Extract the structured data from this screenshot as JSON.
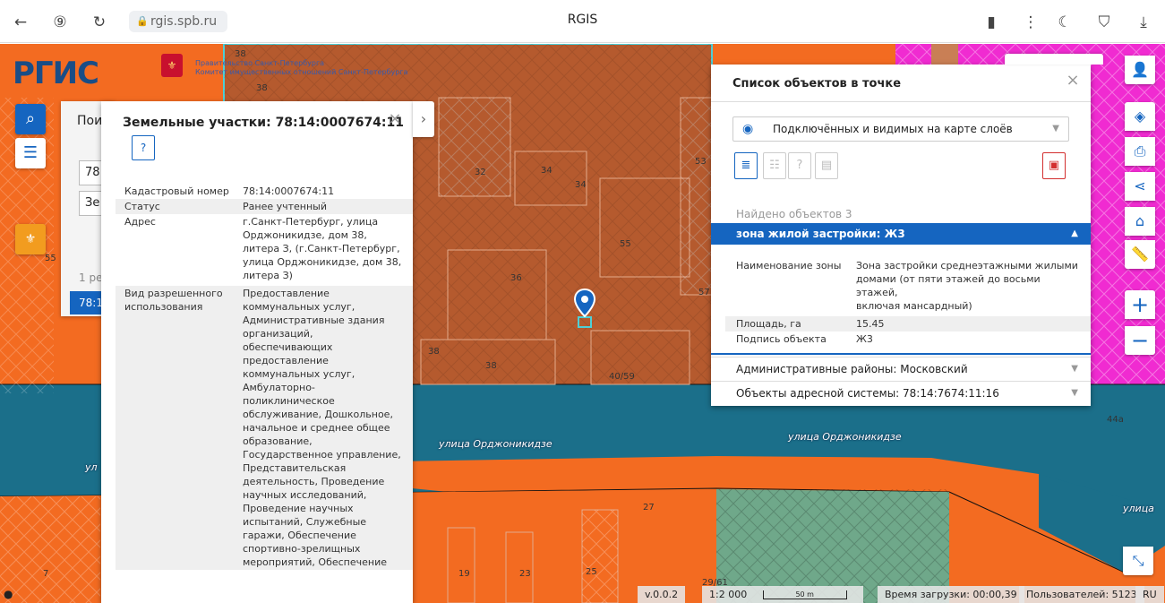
{
  "browser": {
    "url": "rgis.spb.ru",
    "title": "RGIS"
  },
  "map": {
    "logo_text": "РГИС",
    "gov_line1": "Правительство Санкт-Петербурга",
    "gov_line2": "Комитет имущественных отношений Санкт-Петербурга",
    "building_numbers": [
      "38",
      "38",
      "32",
      "34",
      "34",
      "53",
      "55",
      "36",
      "57",
      "38",
      "38",
      "40/59",
      "27",
      "19",
      "23",
      "25",
      "29/61",
      "7",
      "44a",
      "55"
    ],
    "streets": [
      "улица Орджоникидзе",
      "улица Орджоникидзе",
      "улица",
      "ул"
    ]
  },
  "colors": {
    "accent": "#1565c0",
    "orange_zone": "#f36b21",
    "selected_zone": "#b55a2e",
    "road": "#1b6f8a",
    "magenta_zone": "#f02bd1"
  },
  "search_panel": {
    "header": "Пои",
    "field1_value": "78:",
    "field2_value": "Зе",
    "count_text": "1 ре",
    "result_text": "78:1"
  },
  "plot_panel": {
    "title": "Земельные участки: 78:14:0007674:11",
    "rows": [
      {
        "key": "Кадастровый номер",
        "value": "78:14:0007674:11"
      },
      {
        "key": "Статус",
        "value": "Ранее учтенный"
      },
      {
        "key": "Адрес",
        "value": "г.Санкт-Петербург, улица\nОрджоникидзе, дом 38,\nлитера З, (г.Санкт-Петербург,\nулица Орджоникидзе, дом 38,\nлитера З)"
      },
      {
        "key": "Вид разрешенного\nиспользования",
        "value": "Предоставление\nкоммунальных услуг,\nАдминистративные здания\nорганизаций,\nобеспечивающих\nпредоставление\nкоммунальных услуг,\nАмбулаторно-\nполиклиническое\nобслуживание, Дошкольное,\nначальное и среднее общее\nобразование,\nГосударственное управление,\nПредставительская\nдеятельность, Проведение\nнаучных исследований,\nПроведение научных\nиспытаний, Служебные\nгаражи, Обеспечение\nспортивно-зрелищных\nмероприятий, Обеспечение"
      }
    ]
  },
  "objects_panel": {
    "title": "Список объектов в точке",
    "layer_select": "Подключённых и видимых на карте слоёв",
    "found_text": "Найдено объектов 3",
    "open_section": "зона жилой застройки: Ж3",
    "rows": [
      {
        "key": "Наименование зоны",
        "value": "Зона застройки среднеэтажными жилыми\nдомами (от пяти этажей до восьми этажей,\nвключая мансардный)"
      },
      {
        "key": "Площадь, га",
        "value": "15.45"
      },
      {
        "key": "Подпись объекта",
        "value": "Ж3"
      }
    ],
    "section2": "Административные районы: Московский",
    "section3": "Объекты адресной системы: 78:14:7674:11:16"
  },
  "status_bar": {
    "version": "v.0.0.2",
    "scale": "1:2 000",
    "scale_bar_label": "50 m",
    "load_time": "Время загрузки: 00:00,39",
    "users": "Пользователей: 5123",
    "lang": "RU"
  },
  "icons": {
    "search": "search-icon",
    "menu": "menu-icon",
    "layers": "layers-icon",
    "print": "print-icon",
    "share": "share-icon",
    "house": "house-icon",
    "ruler": "ruler-icon",
    "zoom_in": "plus-icon",
    "zoom_out": "minus-icon",
    "user": "user-icon",
    "fullscreen": "fullscreen-icon"
  }
}
